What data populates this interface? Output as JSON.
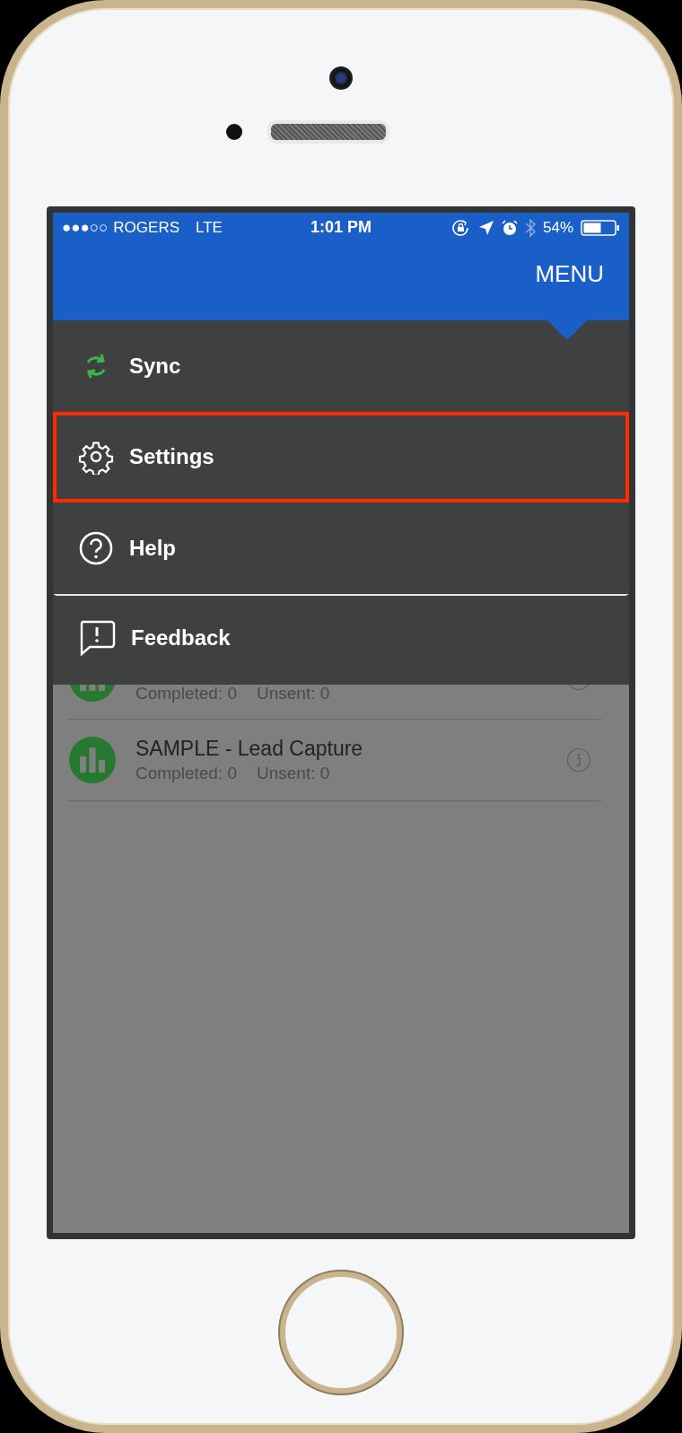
{
  "status_bar": {
    "signal": "●●●○○",
    "carrier": "ROGERS",
    "network": "LTE",
    "time": "1:01 PM",
    "battery": "54%"
  },
  "header": {
    "title": "MENU"
  },
  "menu": [
    {
      "kind": "sync",
      "label": "Sync",
      "highlighted": false,
      "divider": false
    },
    {
      "kind": "settings",
      "label": "Settings",
      "highlighted": true,
      "divider": false
    },
    {
      "kind": "help",
      "label": "Help",
      "highlighted": false,
      "divider": false
    },
    {
      "kind": "feedback",
      "label": "Feedback",
      "highlighted": false,
      "divider": true
    }
  ],
  "forms": [
    {
      "completed": "Completed: 0",
      "unsent": "Unsent: 0"
    },
    {
      "title": "SAMPLE - Lead Capture",
      "completed": "Completed: 0",
      "unsent": "Unsent: 0"
    }
  ]
}
